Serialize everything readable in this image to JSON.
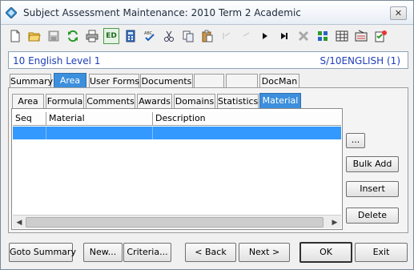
{
  "window": {
    "title": "Subject Assessment Maintenance:  2010 Term 2 Academic",
    "close_label": "✕"
  },
  "toolbar": {
    "icons": [
      "new-icon",
      "open-icon",
      "save-icon",
      "refresh-icon",
      "print-icon",
      "edit-icon",
      "calculator-icon",
      "spellcheck-icon",
      "cut-icon",
      "copy-icon",
      "paste-icon",
      "first-icon",
      "prev-icon",
      "next-icon",
      "last-icon",
      "delete-icon",
      "tree-icon",
      "grid-icon",
      "permissions-icon",
      "checklist-icon"
    ],
    "edit_label": "ED"
  },
  "record": {
    "left": "10 English Level 1",
    "right": "S/10ENGLISH (1)"
  },
  "main_tabs": [
    "Summary",
    "Area",
    "User Forms",
    "Documents",
    "",
    "",
    "DocMan"
  ],
  "main_tab_selected": "Area",
  "sub_tabs": [
    "Area",
    "Formula",
    "Comments",
    "Awards",
    "Domains",
    "Statistics",
    "Material"
  ],
  "sub_tab_selected": "Material",
  "grid": {
    "columns": [
      "Seq",
      "Material",
      "Description"
    ],
    "rows": [
      [
        "",
        "",
        ""
      ]
    ]
  },
  "side_buttons": {
    "ellipsis": "...",
    "bulk_add": "Bulk Add",
    "insert": "Insert",
    "delete": "Delete"
  },
  "bottom_buttons": {
    "goto_summary": "Goto Summary",
    "new": "New...",
    "criteria": "Criteria...",
    "back": "< Back",
    "next": "Next >",
    "ok": "OK",
    "exit": "Exit"
  },
  "colors": {
    "selected_tab": "#3c8fdc",
    "selected_row": "#3399ff",
    "record_text": "#1f3fb8"
  }
}
